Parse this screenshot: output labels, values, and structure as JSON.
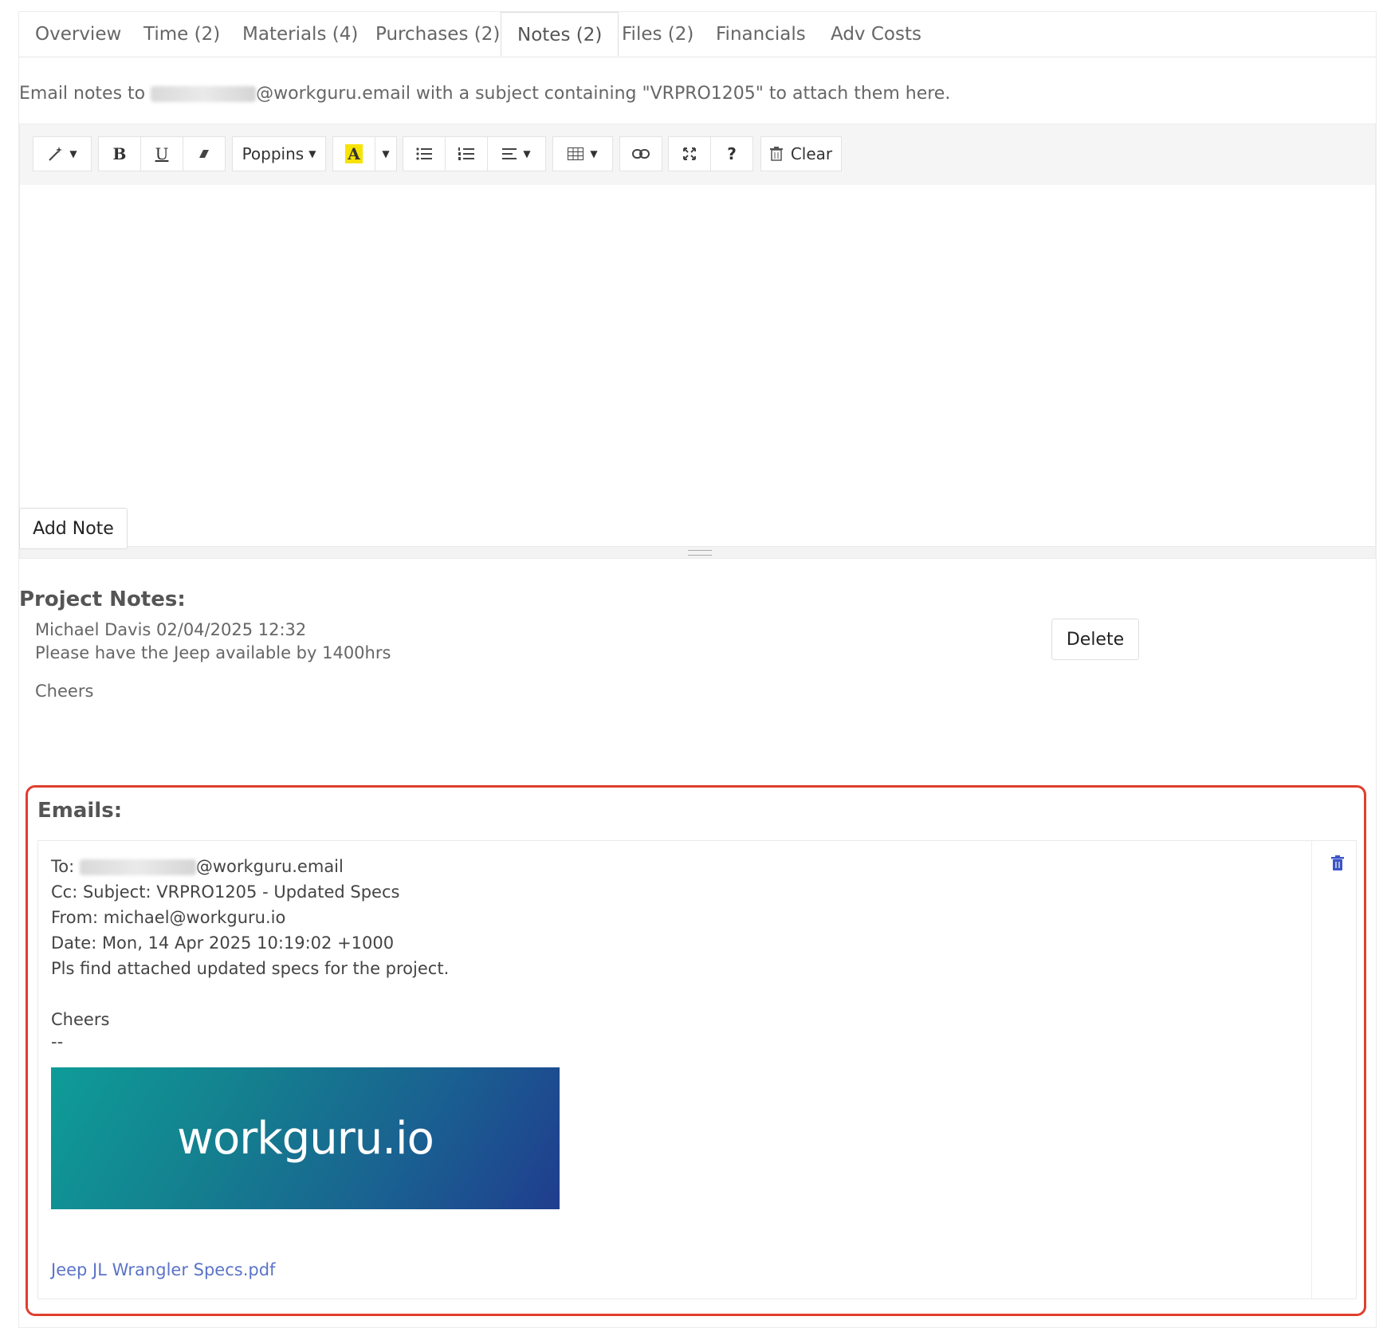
{
  "tabs": [
    {
      "label": "Overview"
    },
    {
      "label": "Time (2)"
    },
    {
      "label": "Materials (4)"
    },
    {
      "label": "Purchases (2)"
    },
    {
      "label": "Notes (2)"
    },
    {
      "label": "Files (2)"
    },
    {
      "label": "Financials"
    },
    {
      "label": "Adv Costs"
    }
  ],
  "active_tab": "Notes (2)",
  "hint": {
    "prefix": "Email notes to ",
    "suffix": "@workguru.email with a subject containing \"VRPRO1205\" to attach them here."
  },
  "toolbar": {
    "font_label": "Poppins",
    "clear_label": "Clear",
    "help_label": "?",
    "icons": [
      "magic-wand-icon",
      "bold-icon",
      "underline-icon",
      "eraser-icon",
      "font-color-icon",
      "unordered-list-icon",
      "ordered-list-icon",
      "align-icon",
      "table-icon",
      "link-icon",
      "fullscreen-icon",
      "help-icon",
      "trash-icon"
    ],
    "highlight_color": "#f7e300"
  },
  "add_note_label": "Add Note",
  "project_notes": {
    "heading": "Project Notes:",
    "author_line": "Michael Davis 02/04/2025 12:32",
    "body_line": "Please have the Jeep available by 1400hrs",
    "sign_off": "Cheers",
    "delete_label": "Delete"
  },
  "emails": {
    "heading": "Emails:",
    "to_prefix": "To: ",
    "to_suffix": "@workguru.email",
    "cc_subject": "Cc: Subject: VRPRO1205 - Updated Specs",
    "from": "From: michael@workguru.io",
    "date": "Date: Mon, 14 Apr 2025 10:19:02 +1000",
    "body": "Pls find attached updated specs for the project.",
    "sign_off": "Cheers",
    "dashes": "--",
    "logo_text": "workguru.io",
    "attachment": "Jeep JL Wrangler Specs.pdf"
  },
  "colors": {
    "highlight_border": "#e03e2d",
    "link": "#5b73c8",
    "trash_icon": "#3b55c9"
  }
}
